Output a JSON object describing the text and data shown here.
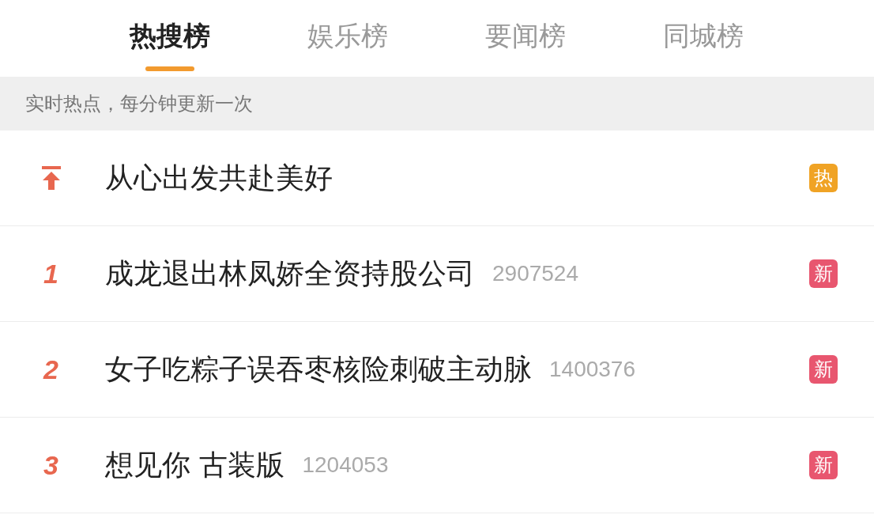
{
  "tabs": [
    {
      "label": "热搜榜",
      "selected": true
    },
    {
      "label": "娱乐榜",
      "selected": false
    },
    {
      "label": "要闻榜",
      "selected": false
    },
    {
      "label": "同城榜",
      "selected": false
    }
  ],
  "notice": "实时热点，每分钟更新一次",
  "items": [
    {
      "kind": "pinned",
      "title": "从心出发共赴美好",
      "badge": {
        "kind": "hot",
        "text": "热"
      }
    },
    {
      "kind": "ranked",
      "rank": "1",
      "title": "成龙退出林凤娇全资持股公司",
      "count": "2907524",
      "badge": {
        "kind": "new",
        "text": "新"
      }
    },
    {
      "kind": "ranked",
      "rank": "2",
      "title": "女子吃粽子误吞枣核险刺破主动脉",
      "count": "1400376",
      "badge": {
        "kind": "new",
        "text": "新"
      }
    },
    {
      "kind": "ranked",
      "rank": "3",
      "title": "想见你 古装版",
      "count": "1204053",
      "badge": {
        "kind": "new",
        "text": "新"
      }
    }
  ]
}
